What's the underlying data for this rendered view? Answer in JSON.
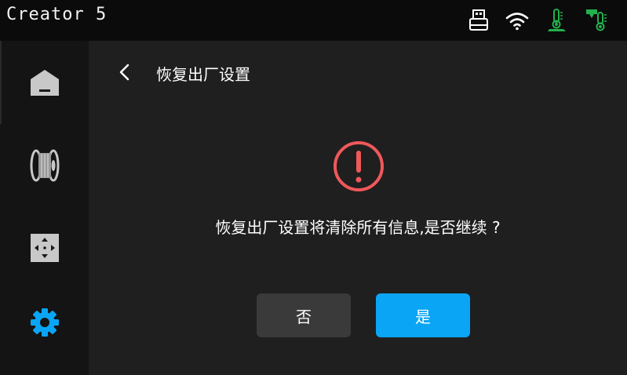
{
  "app": {
    "title": "Creator 5"
  },
  "status_icons": [
    {
      "name": "usb-icon"
    },
    {
      "name": "wifi-icon"
    },
    {
      "name": "chamber-temperature-icon",
      "color": "#22b14c"
    },
    {
      "name": "nozzle-temperature-icon",
      "color": "#22b14c"
    }
  ],
  "sidebar": {
    "items": [
      {
        "name": "home-icon",
        "active": false
      },
      {
        "name": "filament-icon",
        "active": false
      },
      {
        "name": "move-icon",
        "active": false
      },
      {
        "name": "settings-gear-icon",
        "active": true,
        "color": "#0aa5f5"
      }
    ]
  },
  "header": {
    "title": "恢复出厂设置"
  },
  "dialog": {
    "message": "恢复出厂设置将清除所有信息,是否继续 ?",
    "warning_color": "#f0585a",
    "no_label": "否",
    "yes_label": "是",
    "yes_color": "#0aa5f5"
  }
}
